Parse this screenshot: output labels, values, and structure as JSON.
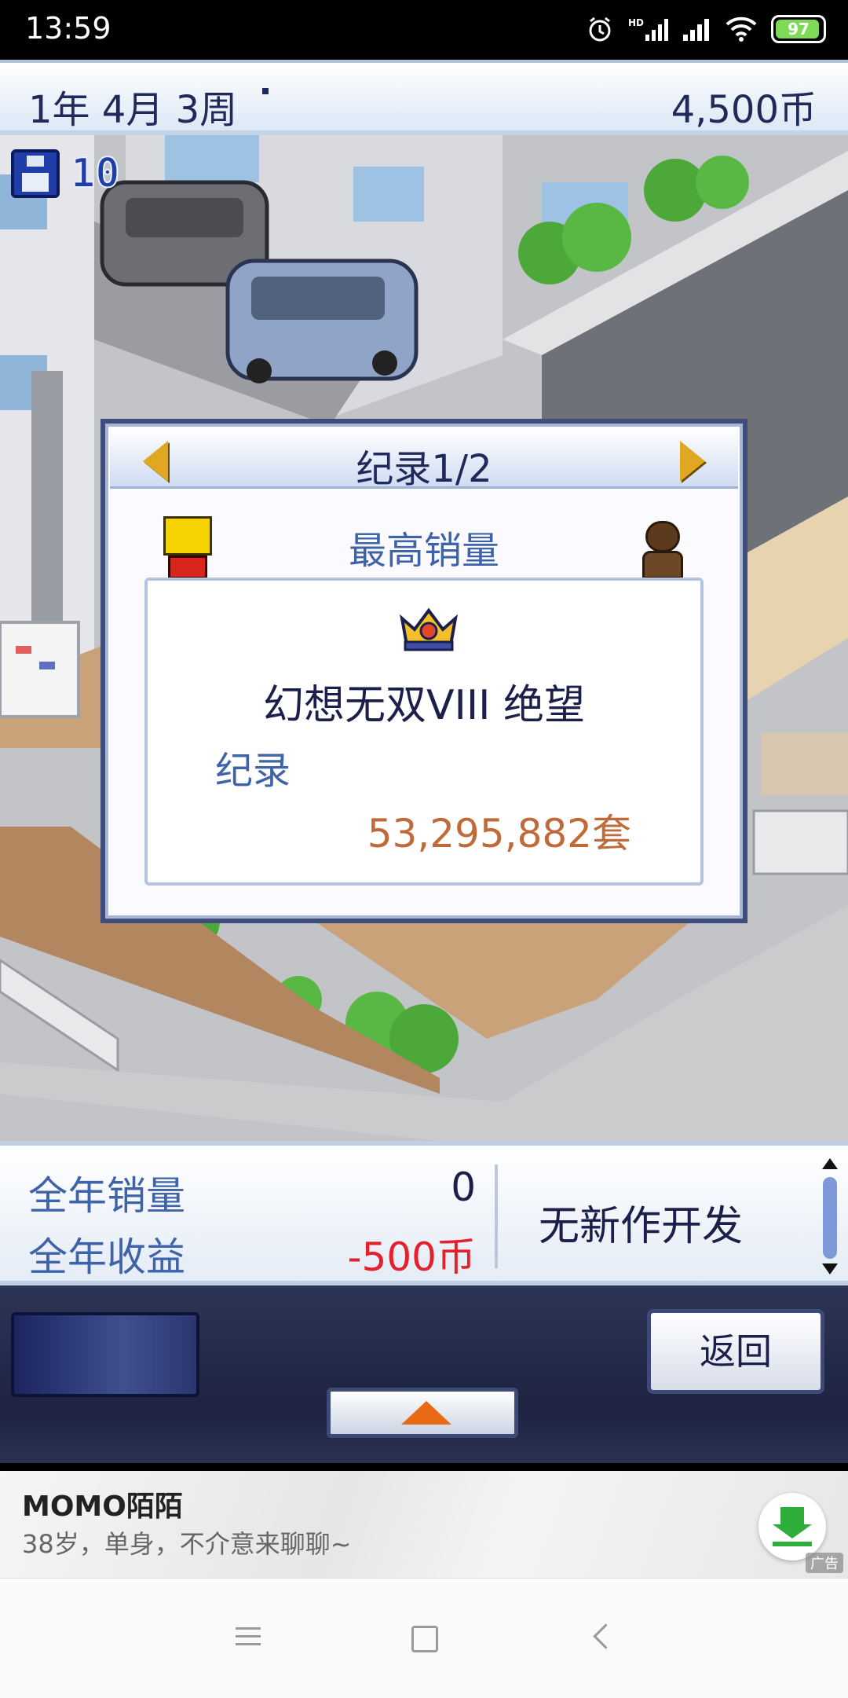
{
  "status_bar": {
    "time": "13:59",
    "battery": "97",
    "network": "HD"
  },
  "top_bar": {
    "date": "1年 4月 3周",
    "money": "4,500币"
  },
  "save_badge": {
    "count": "10"
  },
  "dialog": {
    "title": "纪录1/2",
    "category": "最高销量",
    "game_title": "幻想无双VIII 绝望",
    "record_label": "纪录",
    "record_value": "53,295,882套"
  },
  "info_panel": {
    "annual_sales_label": "全年销量",
    "annual_sales_value": "0",
    "annual_income_label": "全年收益",
    "annual_income_value": "-500币",
    "project_status": "无新作开发"
  },
  "controls": {
    "back_label": "返回"
  },
  "ad": {
    "title": "MOMO陌陌",
    "subtitle": "38岁，单身，不介意来聊聊~",
    "tag": "广告"
  },
  "colors": {
    "panel_navy": "#1f2a5a",
    "accent_blue": "#3f63a8",
    "record_orange": "#c06a3a",
    "negative_red": "#e4202a",
    "download_green": "#2fae3c"
  }
}
